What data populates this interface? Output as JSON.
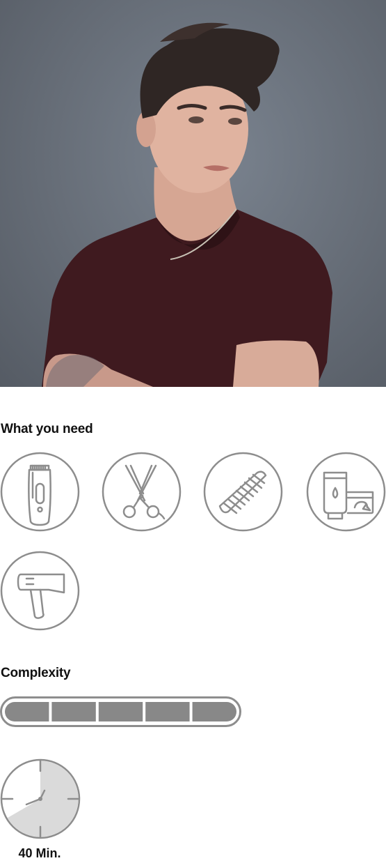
{
  "sections": {
    "what_you_need": "What you need",
    "complexity": "Complexity"
  },
  "tools": [
    {
      "icon": "hair-clipper-icon"
    },
    {
      "icon": "scissors-icon"
    },
    {
      "icon": "comb-icon"
    },
    {
      "icon": "styling-products-icon"
    },
    {
      "icon": "hair-dryer-icon"
    }
  ],
  "complexity": {
    "level": 5,
    "max": 5
  },
  "duration": {
    "label": "40 Min.",
    "minutes": 40
  },
  "colors": {
    "icon_stroke": "#8d8d8d",
    "bar_fill": "#888888",
    "clock_fill": "#dadada",
    "text": "#111111"
  }
}
